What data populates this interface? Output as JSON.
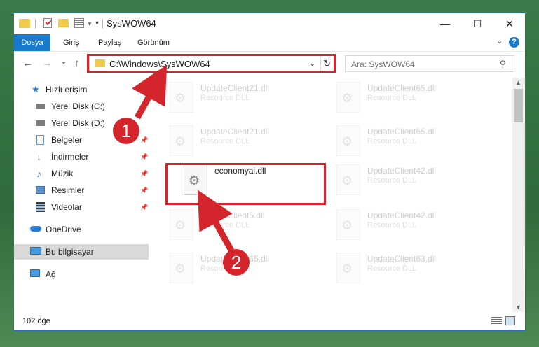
{
  "window": {
    "title": "SysWOW64",
    "controls": {
      "minimize": "—",
      "maximize": "☐",
      "close": "✕"
    }
  },
  "ribbon": {
    "tabs": [
      "Dosya",
      "Giriş",
      "Paylaş",
      "Görünüm"
    ],
    "help": "?"
  },
  "nav": {
    "back": "←",
    "forward": "→",
    "recent": "⌄",
    "up": "↑",
    "address": "C:\\Windows\\SysWOW64",
    "search_placeholder": "Ara: SysWOW64"
  },
  "sidebar": {
    "items": [
      {
        "label": "Hızlı erişim",
        "icon": "star-icon"
      },
      {
        "label": "Yerel Disk (C:)",
        "icon": "drive-icon"
      },
      {
        "label": "Yerel Disk (D:)",
        "icon": "drive-icon"
      },
      {
        "label": "Belgeler",
        "icon": "documents-icon"
      },
      {
        "label": "İndirmeler",
        "icon": "download-icon"
      },
      {
        "label": "Müzik",
        "icon": "music-icon"
      },
      {
        "label": "Resimler",
        "icon": "pictures-icon"
      },
      {
        "label": "Videolar",
        "icon": "videos-icon"
      },
      {
        "label": "OneDrive",
        "icon": "cloud-icon"
      },
      {
        "label": "Bu bilgisayar",
        "icon": "computer-icon"
      },
      {
        "label": "Ağ",
        "icon": "network-icon"
      }
    ]
  },
  "files": {
    "highlighted": {
      "name": "economyai.dll"
    },
    "faded": [
      {
        "name": "UpdateClient21.dll",
        "type": "Resource DLL"
      },
      {
        "name": "UpdateClient65.dll",
        "type": "Resource DLL"
      },
      {
        "name": "UpdateClient21.dll",
        "type": "Resource DLL"
      },
      {
        "name": "UpdateClient65.dll",
        "type": "Resource DLL"
      },
      {
        "name": "UpdateClient42.dll",
        "type": "Resource DLL"
      },
      {
        "name": "UpdateClient5.dll",
        "type": "Resource DLL"
      },
      {
        "name": "UpdateClient42.dll",
        "type": "Resource DLL"
      },
      {
        "name": "UpdateClient65.dll",
        "type": "Resource DLL"
      },
      {
        "name": "UpdateClient63.dll",
        "type": "Resource DLL"
      }
    ]
  },
  "status": {
    "item_count": "102 öğe"
  },
  "callouts": {
    "one": "1",
    "two": "2",
    "color": "#d3252b"
  }
}
